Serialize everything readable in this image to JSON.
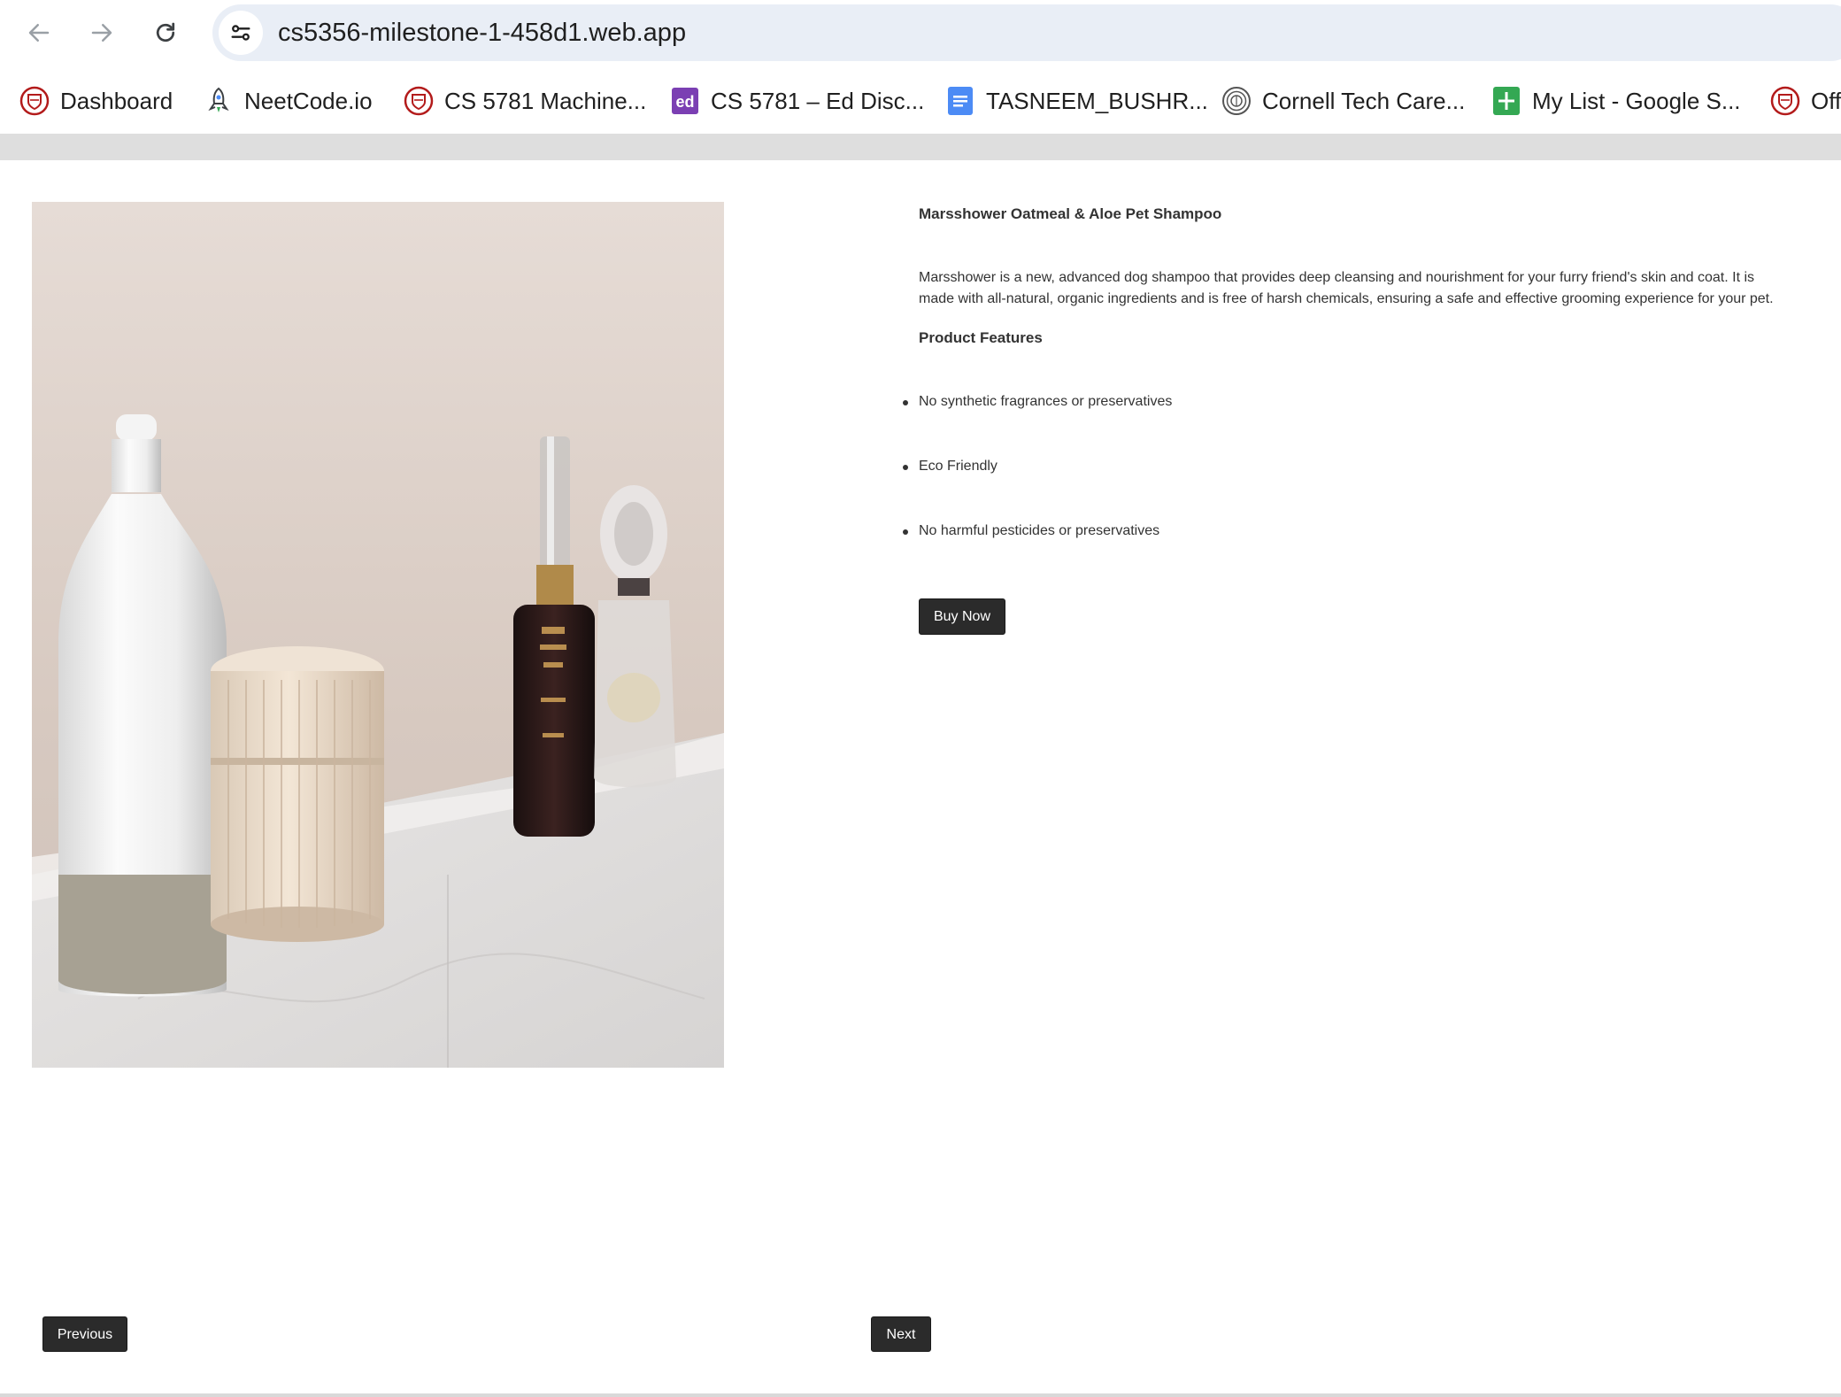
{
  "browser": {
    "url": "cs5356-milestone-1-458d1.web.app",
    "bookmarks": [
      {
        "label": "Dashboard",
        "icon": "cornell-shield-icon"
      },
      {
        "label": "NeetCode.io",
        "icon": "rocket-icon"
      },
      {
        "label": "CS 5781 Machine...",
        "icon": "cornell-shield-icon"
      },
      {
        "label": "CS 5781 – Ed Disc...",
        "icon": "ed-icon"
      },
      {
        "label": "TASNEEM_BUSHR...",
        "icon": "google-docs-icon"
      },
      {
        "label": "Cornell Tech Care...",
        "icon": "cornell-seal-icon"
      },
      {
        "label": "My List - Google S...",
        "icon": "google-sheets-icon"
      },
      {
        "label": "Off",
        "icon": "cornell-shield-icon"
      }
    ]
  },
  "product": {
    "image_alt": "product-photo-bottles-and-jar",
    "title": "Marsshower Oatmeal & Aloe Pet Shampoo",
    "description": "Marsshower is a new, advanced dog shampoo that provides deep cleansing and nourishment for your furry friend's skin and coat. It is made with all-natural, organic ingredients and is free of harsh chemicals, ensuring a safe and effective grooming experience for your pet.",
    "features_title": "Product Features",
    "features": [
      "No synthetic fragrances or preservatives",
      "Eco Friendly",
      "No harmful pesticides or preservatives"
    ],
    "buy_label": "Buy Now"
  },
  "pagination": {
    "previous_label": "Previous",
    "next_label": "Next"
  },
  "colors": {
    "button_bg": "#2b2b2b",
    "omnibox_bg": "#e9eef6",
    "ed_purple": "#7b3fb3",
    "docs_blue": "#4c8bf5",
    "sheets_green": "#34a853",
    "cornell_red": "#b31b1b"
  }
}
